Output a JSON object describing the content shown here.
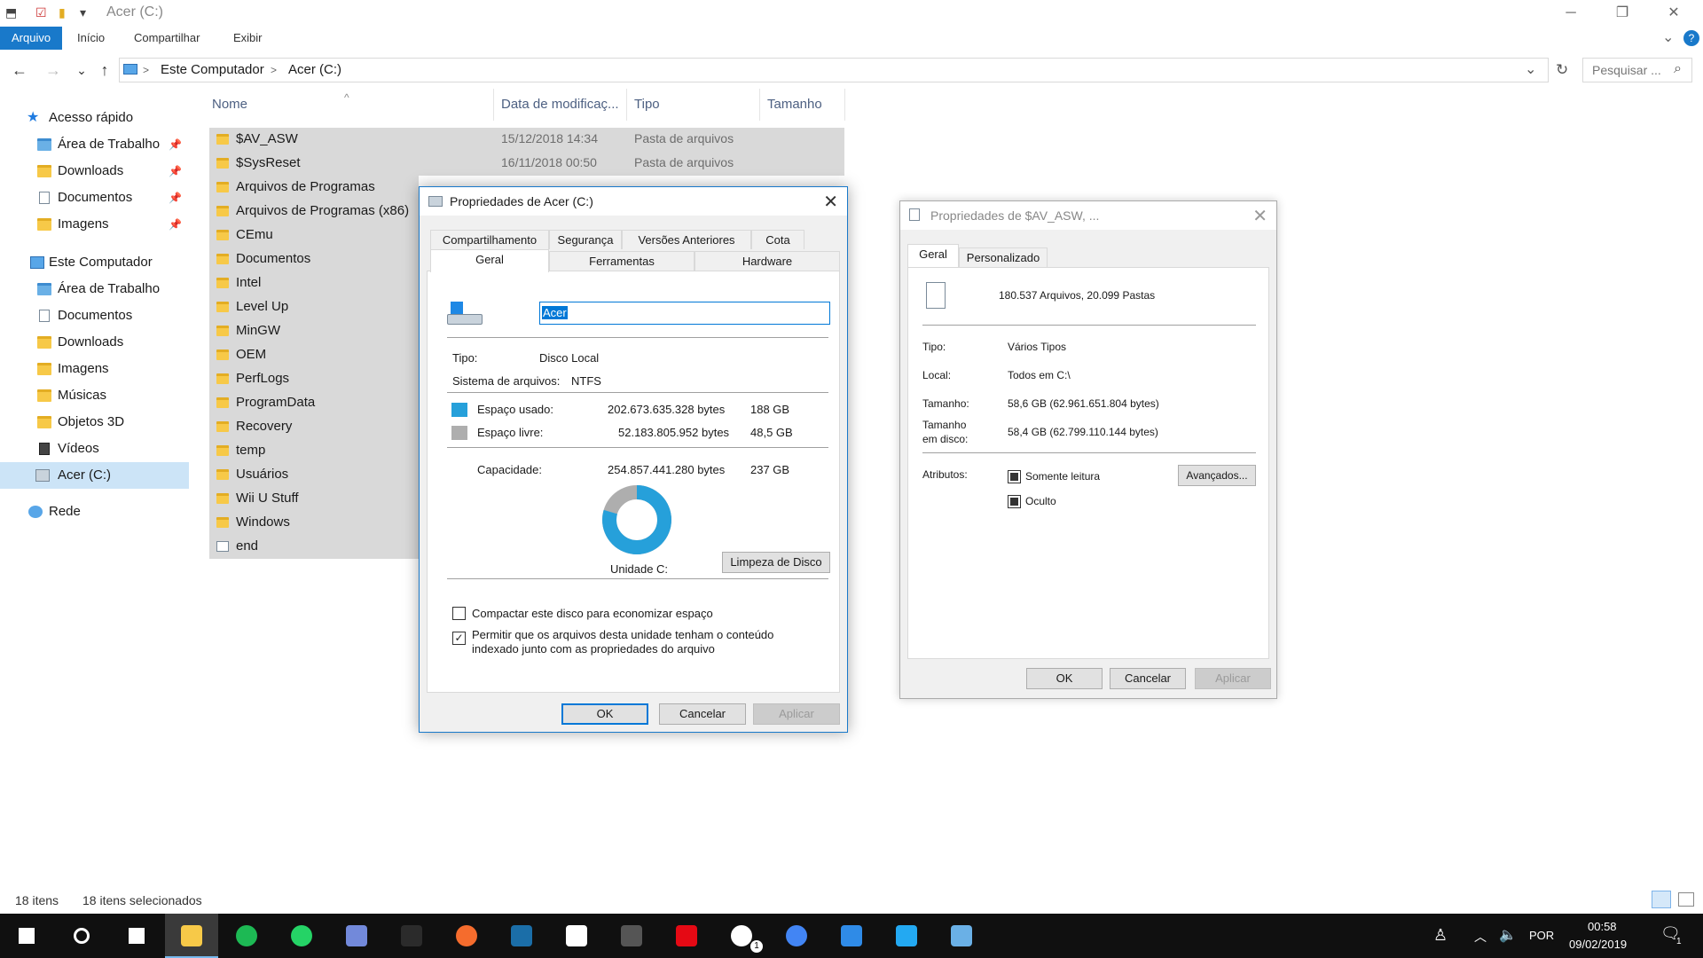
{
  "window": {
    "title": "Acer (C:)",
    "minimize": "─",
    "maximize": "❐",
    "close": "✕"
  },
  "ribbon": {
    "tabs": [
      "Arquivo",
      "Início",
      "Compartilhar",
      "Exibir"
    ],
    "help": "?",
    "expand": "⌄"
  },
  "address": {
    "back": "←",
    "forward": "→",
    "recent": "⌄",
    "up": "↑",
    "crumbs": [
      "Este Computador",
      "Acer (C:)"
    ],
    "sep": ">",
    "dropdown": "⌄",
    "refresh": "↻",
    "search_placeholder": "Pesquisar ...",
    "search_icon": "⌕"
  },
  "sidebar": {
    "quick_access": "Acesso rápido",
    "quick_items": [
      "Área de Trabalho",
      "Downloads",
      "Documentos",
      "Imagens"
    ],
    "pin": "📌",
    "this_pc": "Este Computador",
    "pc_items": [
      "Área de Trabalho",
      "Documentos",
      "Downloads",
      "Imagens",
      "Músicas",
      "Objetos 3D",
      "Vídeos",
      "Acer (C:)"
    ],
    "network": "Rede"
  },
  "filelist": {
    "columns": [
      "Nome",
      "Data de modificaç...",
      "Tipo",
      "Tamanho"
    ],
    "sort_indicator": "^",
    "rows": [
      {
        "name": "$AV_ASW",
        "date": "15/12/2018 14:34",
        "type": "Pasta de arquivos"
      },
      {
        "name": "$SysReset",
        "date": "16/11/2018 00:50",
        "type": "Pasta de arquivos"
      },
      {
        "name": "Arquivos de Programas",
        "date": "",
        "type": ""
      },
      {
        "name": "Arquivos de Programas (x86)",
        "date": "",
        "type": ""
      },
      {
        "name": "CEmu",
        "date": "",
        "type": ""
      },
      {
        "name": "Documentos",
        "date": "",
        "type": ""
      },
      {
        "name": "Intel",
        "date": "",
        "type": ""
      },
      {
        "name": "Level Up",
        "date": "",
        "type": ""
      },
      {
        "name": "MinGW",
        "date": "",
        "type": ""
      },
      {
        "name": "OEM",
        "date": "",
        "type": ""
      },
      {
        "name": "PerfLogs",
        "date": "",
        "type": ""
      },
      {
        "name": "ProgramData",
        "date": "",
        "type": ""
      },
      {
        "name": "Recovery",
        "date": "",
        "type": ""
      },
      {
        "name": "temp",
        "date": "",
        "type": ""
      },
      {
        "name": "Usuários",
        "date": "",
        "type": ""
      },
      {
        "name": "Wii U Stuff",
        "date": "",
        "type": ""
      },
      {
        "name": "Windows",
        "date": "",
        "type": ""
      },
      {
        "name": "end",
        "date": "",
        "type": ""
      }
    ]
  },
  "status": {
    "count": "18 itens",
    "selected": "18 itens selecionados"
  },
  "drive_dialog": {
    "title": "Propriedades de Acer (C:)",
    "close": "✕",
    "tabs_top": [
      "Compartilhamento",
      "Segurança",
      "Versões Anteriores",
      "Cota"
    ],
    "tabs_bottom": [
      "Geral",
      "Ferramentas",
      "Hardware"
    ],
    "name_value": "Acer",
    "type_label": "Tipo:",
    "type_value": "Disco Local",
    "fs_label": "Sistema de arquivos:",
    "fs_value": "NTFS",
    "used_label": "Espaço usado:",
    "used_bytes": "202.673.635.328 bytes",
    "used_gb": "188 GB",
    "free_label": "Espaço livre:",
    "free_bytes": "52.183.805.952 bytes",
    "free_gb": "48,5 GB",
    "cap_label": "Capacidade:",
    "cap_bytes": "254.857.441.280 bytes",
    "cap_gb": "237 GB",
    "used_fraction": 0.795,
    "used_color": "#26a0da",
    "free_color": "#aeaeae",
    "drive_label": "Unidade C:",
    "cleanup": "Limpeza de Disco",
    "compress": "Compactar este disco para economizar espaço",
    "index_line1": "Permitir que os arquivos desta unidade tenham o conteúdo",
    "index_line2": "indexado junto com as propriedades do arquivo",
    "index_checked": "✓",
    "ok": "OK",
    "cancel": "Cancelar",
    "apply": "Aplicar"
  },
  "folder_dialog": {
    "title": "Propriedades de $AV_ASW, ...",
    "close": "✕",
    "tabs": [
      "Geral",
      "Personalizado"
    ],
    "summary": "180.537 Arquivos, 20.099 Pastas",
    "type_label": "Tipo:",
    "type_value": "Vários Tipos",
    "loc_label": "Local:",
    "loc_value": "Todos em C:\\",
    "size_label": "Tamanho:",
    "size_value": "58,6 GB (62.961.651.804 bytes)",
    "disk_label_1": "Tamanho",
    "disk_label_2": "em disco:",
    "disk_value": "58,4 GB (62.799.110.144 bytes)",
    "attr_label": "Atributos:",
    "readonly": "Somente leitura",
    "hidden": "Oculto",
    "advanced": "Avançados...",
    "ok": "OK",
    "cancel": "Cancelar",
    "apply": "Aplicar"
  },
  "taskbar": {
    "apps": [
      {
        "name": "start",
        "color": "#ffffff"
      },
      {
        "name": "cortana",
        "color": "#ffffff"
      },
      {
        "name": "task-view",
        "color": "#ffffff"
      },
      {
        "name": "file-explorer",
        "color": "#f7c948"
      },
      {
        "name": "spotify",
        "color": "#1db954"
      },
      {
        "name": "whatsapp",
        "color": "#25d366"
      },
      {
        "name": "discord",
        "color": "#7289da"
      },
      {
        "name": "notion",
        "color": "#2b2b2b"
      },
      {
        "name": "origin",
        "color": "#f56c2d"
      },
      {
        "name": "steam",
        "color": "#1b6ea8"
      },
      {
        "name": "notepad",
        "color": "#ffffff"
      },
      {
        "name": "geforce",
        "color": "#555555"
      },
      {
        "name": "netflix",
        "color": "#e50914"
      },
      {
        "name": "xbox",
        "color": "#ffffff"
      },
      {
        "name": "chrome",
        "color": "#4285f4"
      },
      {
        "name": "bluestacks",
        "color": "#2f8be7"
      },
      {
        "name": "vscode",
        "color": "#23a9f2"
      },
      {
        "name": "control-panel",
        "color": "#6ab0e6"
      }
    ],
    "xbox_badge": "1",
    "lang": "POR",
    "time": "00:58",
    "date": "09/02/2019",
    "notif_count": "1"
  }
}
